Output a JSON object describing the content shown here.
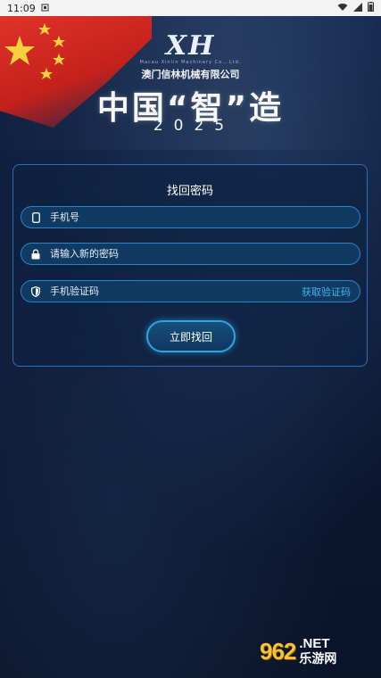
{
  "status_bar": {
    "time": "11:09"
  },
  "header": {
    "logo_mark": "XH",
    "logo_subtitle": "Macau Xinlin Machinery Co., Ltd.",
    "company_name": "澳门信林机械有限公司",
    "slogan": "中国“智”造",
    "year": "2025"
  },
  "form": {
    "title": "找回密码",
    "phone_placeholder": "手机号",
    "new_password_placeholder": "请输入新的密码",
    "code_placeholder": "手机验证码",
    "get_code_label": "获取验证码",
    "submit_label": "立即找回"
  },
  "watermark": {
    "logo": "962",
    "suffix": ".NET",
    "site_cn": "乐游网"
  },
  "colors": {
    "accent": "#3fb6f0",
    "field_bg": "#0f3a62",
    "card_border": "#2f6eb2",
    "flag_red": "#e0322a"
  }
}
